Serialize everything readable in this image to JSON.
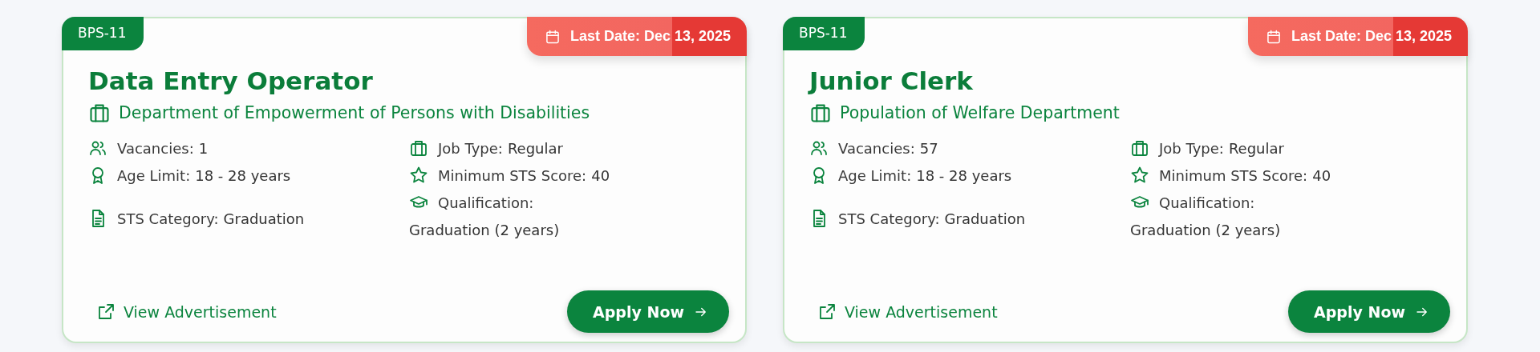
{
  "jobs": [
    {
      "grade": "BPS-11",
      "last_date": "Last Date: Dec 13, 2025",
      "title": "Data Entry Operator",
      "department": "Department of Empowerment of Persons with Disabilities",
      "column_1": [
        {
          "kind": "vacancies",
          "label": "Vacancies:",
          "value": "1"
        },
        {
          "kind": "age",
          "label": "Age Limit:",
          "value": "18 - 28 years"
        },
        {
          "kind": "category",
          "label": "STS Category:",
          "value": "Graduation"
        }
      ],
      "column_2": [
        {
          "kind": "job_type",
          "label": "Job Type:",
          "value": "Regular"
        },
        {
          "kind": "score",
          "label": "Minimum STS Score:",
          "value": "40"
        },
        {
          "kind": "qualification",
          "label": "Qualification:",
          "value": "Graduation (2 years)"
        }
      ],
      "link": "View Advertisement",
      "button": "Apply Now"
    },
    {
      "grade": "BPS-11",
      "last_date": "Last Date: Dec 13, 2025",
      "title": "Junior Clerk",
      "department": "Population of Welfare Department",
      "column_1": [
        {
          "kind": "vacancies",
          "label": "Vacancies:",
          "value": "57"
        },
        {
          "kind": "age",
          "label": "Age Limit:",
          "value": "18 - 28 years"
        },
        {
          "kind": "category",
          "label": "STS Category:",
          "value": "Graduation"
        }
      ],
      "column_2": [
        {
          "kind": "job_type",
          "label": "Job Type:",
          "value": "Regular"
        },
        {
          "kind": "score",
          "label": "Minimum STS Score:",
          "value": "40"
        },
        {
          "kind": "qualification",
          "label": "Qualification:",
          "value": "Graduation (2 years)"
        }
      ],
      "link": "View Advertisement",
      "button": "Apply Now"
    }
  ]
}
